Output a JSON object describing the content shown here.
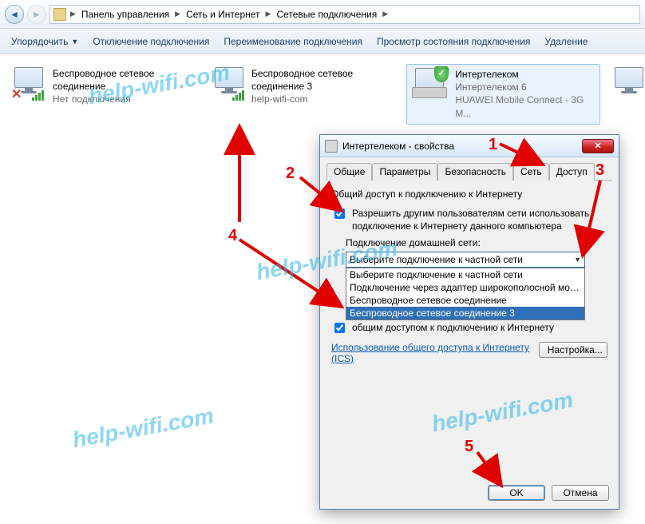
{
  "breadcrumb": {
    "items": [
      "Панель управления",
      "Сеть и Интернет",
      "Сетевые подключения"
    ]
  },
  "toolbar": {
    "organize": "Упорядочить",
    "items": [
      "Отключение подключения",
      "Переименование подключения",
      "Просмотр состояния подключения",
      "Удаление"
    ]
  },
  "connections": [
    {
      "title": "Беспроводное сетевое соединение",
      "line2": "Нет подключения",
      "line3": ""
    },
    {
      "title": "Беспроводное сетевое соединение 3",
      "line2": "help-wifi-com",
      "line3": ""
    },
    {
      "title": "Интертелеком",
      "line2": "Интертелеком 6",
      "line3": "HUAWEI Mobile Connect - 3G M..."
    }
  ],
  "dialog": {
    "title": "Интертелеком - свойства",
    "tabs": [
      "Общие",
      "Параметры",
      "Безопасность",
      "Сеть",
      "Доступ"
    ],
    "heading": "Общий доступ к подключению к Интернету",
    "check1": "Разрешить другим пользователям сети использовать подключение к Интернету данного компьютера",
    "homeNetLabel": "Подключение домашней сети:",
    "comboSelected": "Выберите подключение к частной сети",
    "options": [
      "Выберите подключение к частной сети",
      "Подключение через адаптер широкополосной мобильн",
      "Беспроводное сетевое соединение",
      "Беспроводное сетевое соединение 3"
    ],
    "check2suffix": "общим доступом к подключению к Интернету",
    "icsLink": "Использование общего доступа к Интернету (ICS)",
    "settingsBtn": "Настройка...",
    "ok": "OK",
    "cancel": "Отмена"
  },
  "annotations": {
    "n1": "1",
    "n2": "2",
    "n3": "3",
    "n4": "4",
    "n5": "5"
  },
  "watermark": "help-wifi.com"
}
